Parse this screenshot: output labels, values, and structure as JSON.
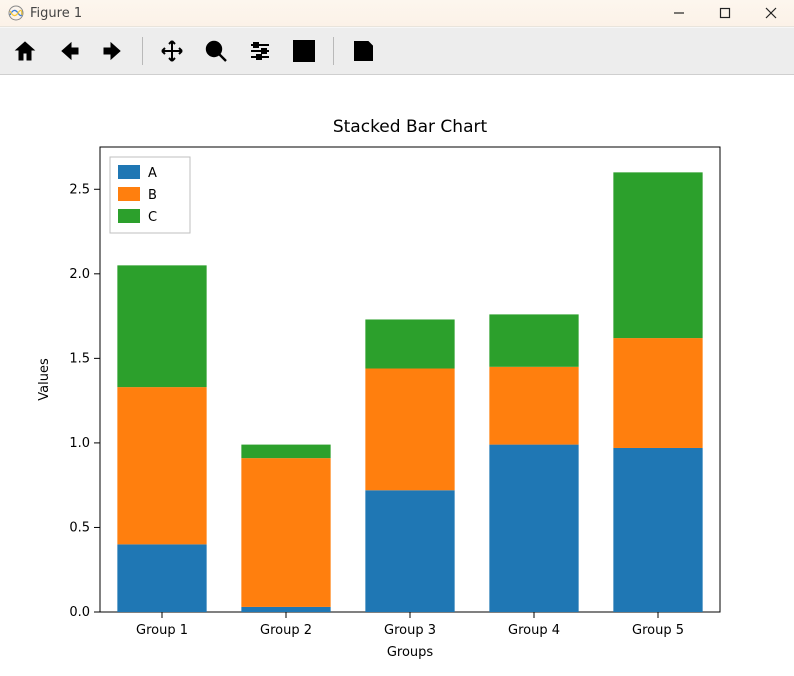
{
  "window": {
    "title": "Figure 1",
    "buttons": {
      "minimize": "Minimize",
      "maximize": "Maximize",
      "close": "Close"
    }
  },
  "toolbar": {
    "home": "Home",
    "back": "Back",
    "forward": "Forward",
    "pan": "Pan",
    "zoom": "Zoom",
    "subplots": "Configure subplots",
    "edit": "Edit parameters",
    "save": "Save"
  },
  "chart_data": {
    "type": "bar",
    "stacked": true,
    "title": "Stacked Bar Chart",
    "xlabel": "Groups",
    "ylabel": "Values",
    "categories": [
      "Group 1",
      "Group 2",
      "Group 3",
      "Group 4",
      "Group 5"
    ],
    "series": [
      {
        "name": "A",
        "color": "#1f77b4",
        "values": [
          0.4,
          0.03,
          0.72,
          0.99,
          0.97
        ]
      },
      {
        "name": "B",
        "color": "#ff7f0e",
        "values": [
          0.93,
          0.88,
          0.72,
          0.46,
          0.65
        ]
      },
      {
        "name": "C",
        "color": "#2ca02c",
        "values": [
          0.72,
          0.08,
          0.29,
          0.31,
          0.98
        ]
      }
    ],
    "yticks": [
      0.0,
      0.5,
      1.0,
      1.5,
      2.0,
      2.5
    ],
    "ylim": [
      0,
      2.75
    ],
    "legend_position": "upper left"
  }
}
